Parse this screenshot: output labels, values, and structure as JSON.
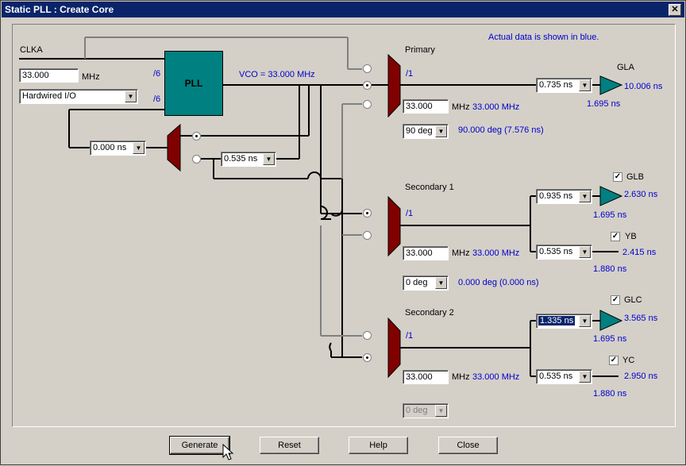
{
  "window": {
    "title": "Static PLL : Create Core",
    "close_glyph": "✕"
  },
  "note": "Actual data is shown in blue.",
  "input": {
    "clock_label": "CLKA",
    "freq_value": "33.000",
    "freq_unit": "MHz",
    "source": "Hardwired I/O",
    "div1": "/6",
    "div2": "/6",
    "feedback_delay": "0.000 ns",
    "feedback_delay2": "0.535 ns"
  },
  "pll": {
    "label": "PLL",
    "vco": "VCO = 33.000 MHz"
  },
  "primary": {
    "title": "Primary",
    "div": "/1",
    "freq": "33.000",
    "unit": "MHz",
    "actual_freq": "33.000 MHz",
    "phase": "90 deg",
    "actual_phase": "90.000 deg (7.576 ns)",
    "out_name": "GLA",
    "delay": "0.735 ns",
    "actual_out": "10.006 ns",
    "actual_delay": "1.695 ns"
  },
  "secondary1": {
    "title": "Secondary 1",
    "div": "/1",
    "freq": "33.000",
    "unit": "MHz",
    "actual_freq": "33.000 MHz",
    "phase": "0 deg",
    "actual_phase": "0.000 deg (0.000 ns)",
    "glb": {
      "name": "GLB",
      "checked": true,
      "delay": "0.935 ns",
      "actual_out": "2.630 ns",
      "actual_delay": "1.695 ns"
    },
    "yb": {
      "name": "YB",
      "checked": true,
      "delay": "0.535 ns",
      "actual_out": "2.415 ns",
      "actual_delay": "1.880 ns"
    }
  },
  "secondary2": {
    "title": "Secondary 2",
    "div": "/1",
    "freq": "33.000",
    "unit": "MHz",
    "actual_freq": "33.000 MHz",
    "phase": "0 deg",
    "glc": {
      "name": "GLC",
      "checked": true,
      "delay": "1.335 ns",
      "actual_out": "3.565 ns",
      "actual_delay": "1.695 ns"
    },
    "yc": {
      "name": "YC",
      "checked": true,
      "delay": "0.535 ns",
      "actual_out": "2.950 ns",
      "actual_delay": "1.880 ns"
    }
  },
  "buttons": {
    "generate": "Generate",
    "reset": "Reset",
    "help": "Help",
    "close": "Close"
  },
  "colors": {
    "mux": "#800000",
    "pll": "#008080",
    "buffer": "#008080",
    "actual": "#0000cc",
    "titlebar": "#0a246a"
  }
}
